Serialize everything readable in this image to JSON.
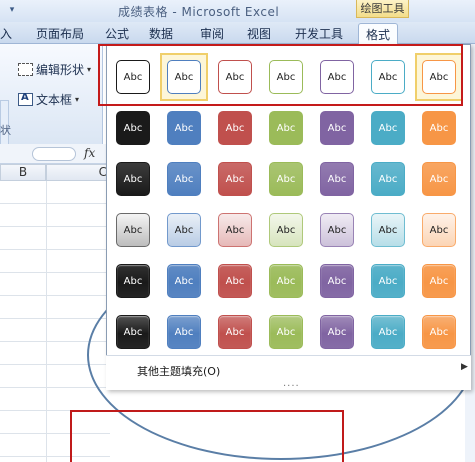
{
  "window": {
    "title": "成绩表格 - Microsoft Excel",
    "context_tab_header": "绘图工具",
    "qat_icon": "quick-access-dropdown-icon"
  },
  "ribbon_tabs": [
    {
      "label": "入"
    },
    {
      "label": "页面布局"
    },
    {
      "label": "公式"
    },
    {
      "label": "数据"
    },
    {
      "label": "审阅"
    },
    {
      "label": "视图"
    },
    {
      "label": "开发工具"
    },
    {
      "label": "格式",
      "active": true
    }
  ],
  "ribbon": {
    "edit_shape": "编辑形状",
    "text_box": "文本框",
    "group_label": "状"
  },
  "formula_bar": {
    "fx": "fx"
  },
  "sheet": {
    "column_headers": [
      "B",
      "C"
    ]
  },
  "gallery": {
    "swatch_text": "Abc",
    "more_fills": "其他主题填充(O)",
    "grip": "....",
    "colors": [
      "#1a1a1a",
      "#4f7fbf",
      "#c0504d",
      "#9bbb59",
      "#8064a2",
      "#4bacc6",
      "#f79646"
    ],
    "rows": [
      "outline",
      "solid",
      "solid",
      "subtle",
      "intense",
      "intense"
    ],
    "selected_row": 0,
    "highlighted": [
      1,
      6
    ]
  }
}
